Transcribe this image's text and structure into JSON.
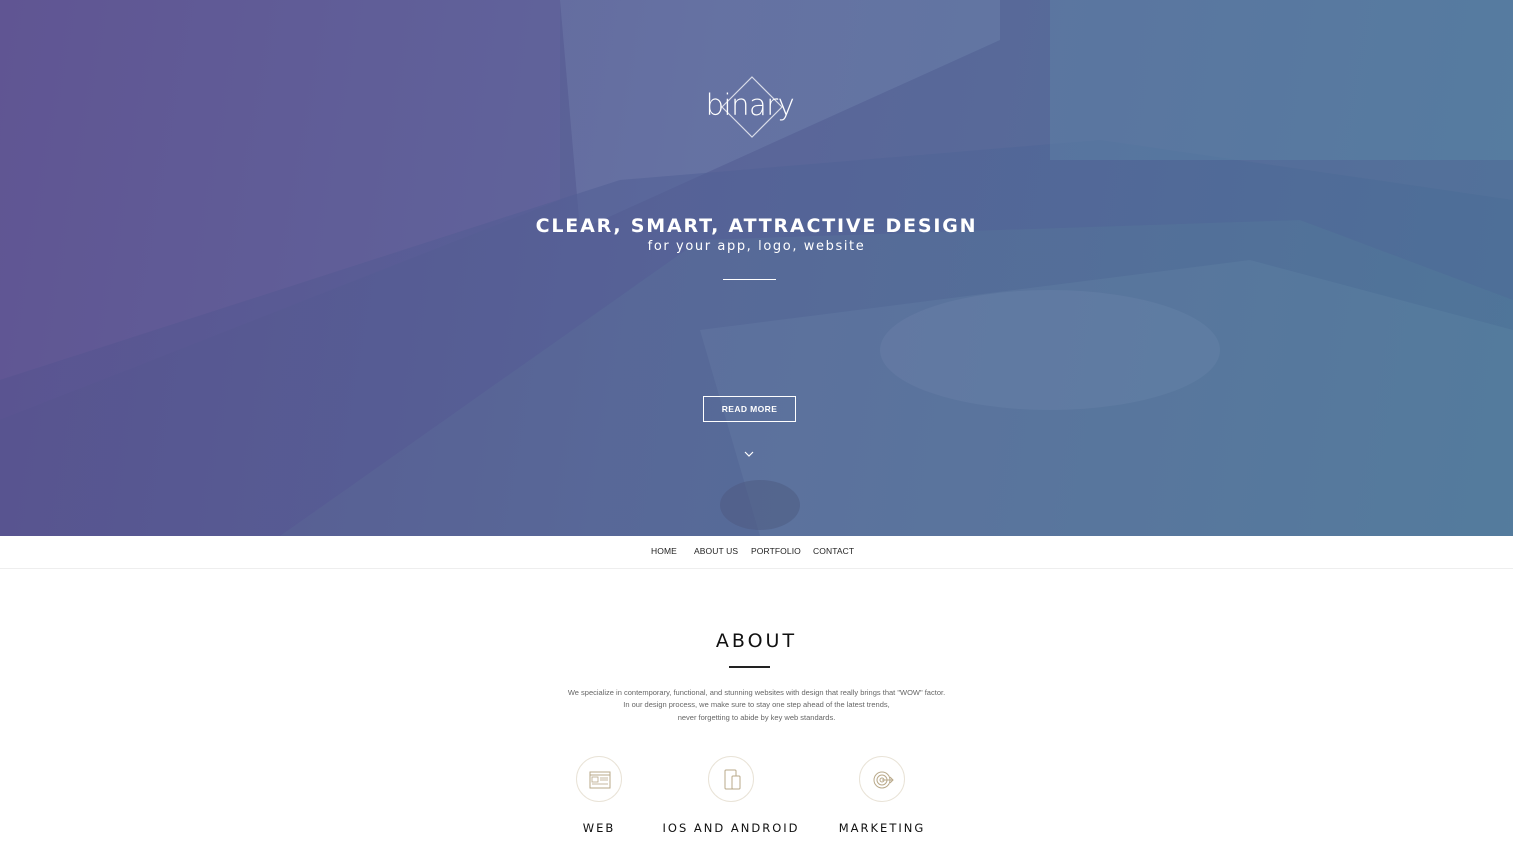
{
  "hero": {
    "logo_text": "binary",
    "headline": "CLEAR, SMART, ATTRACTIVE DESIGN",
    "subline": "for your app, logo, website",
    "read_more_label": "READ MORE",
    "scroll_icon": "chevron-down-icon"
  },
  "nav": {
    "items": [
      {
        "label": "HOME"
      },
      {
        "label": "ABOUT US"
      },
      {
        "label": "PORTFOLIO"
      },
      {
        "label": "CONTACT"
      }
    ]
  },
  "about": {
    "title": "ABOUT",
    "lines": [
      "We specialize in contemporary, functional, and stunning websites with design that really brings that \"WOW\" factor.",
      "In our design process, we make sure to stay one step ahead of the latest trends,",
      "never forgetting to abide by key web standards."
    ],
    "services": [
      {
        "label": "WEB",
        "icon": "browser-window-icon"
      },
      {
        "label": "IOS AND ANDROID",
        "icon": "mobile-devices-icon"
      },
      {
        "label": "MARKETING",
        "icon": "target-icon"
      }
    ]
  },
  "colors": {
    "hero_left": "#5a4a86",
    "hero_right": "#4f7f98",
    "icon_accent": "#b9a98a",
    "text_dark": "#111111"
  }
}
